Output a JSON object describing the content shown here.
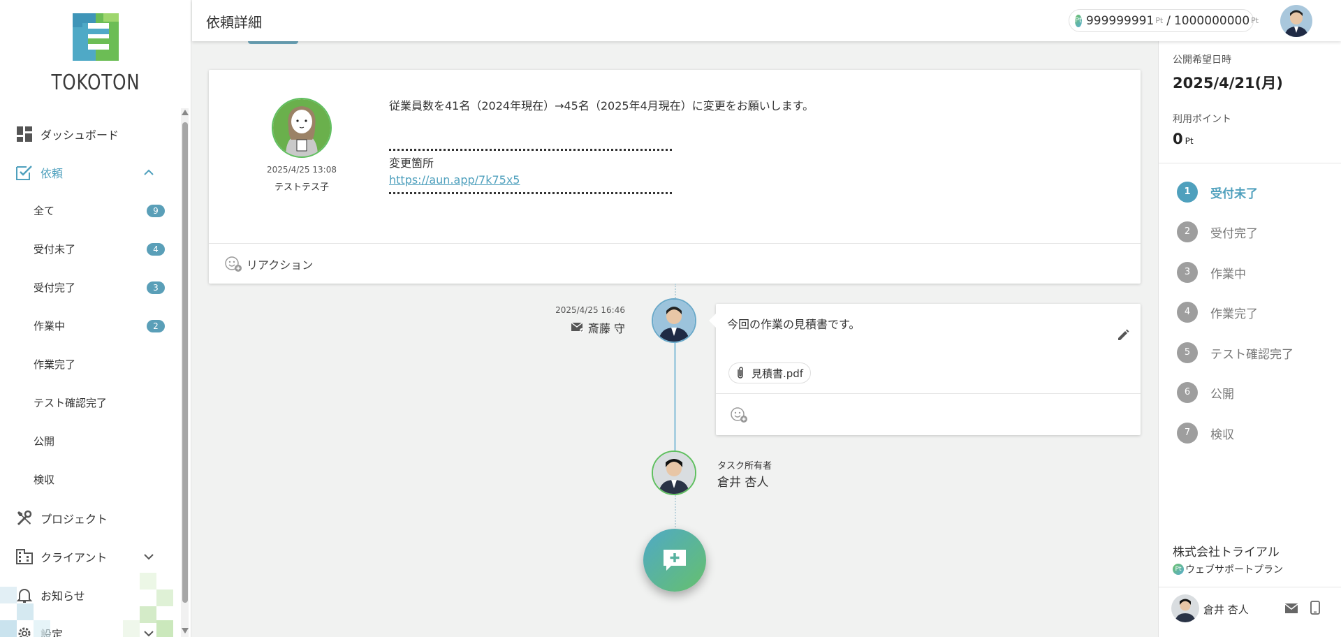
{
  "app": {
    "logo_text": "TOKOTON",
    "brand_colors": {
      "blue": "#4fa0bd",
      "green": "#66c06d",
      "badge": "#5a9fb8"
    }
  },
  "header": {
    "title": "依頼詳細",
    "points_current": "999999991",
    "points_unit": "Pt",
    "points_separator": "/",
    "points_total": "1000000000",
    "pt_badge": "Pt"
  },
  "sidebar": {
    "dashboard": "ダッシュボード",
    "request": "依頼",
    "sub_items": [
      {
        "label": "全て",
        "count": "9"
      },
      {
        "label": "受付未了",
        "count": "4"
      },
      {
        "label": "受付完了",
        "count": "3"
      },
      {
        "label": "作業中",
        "count": "2"
      },
      {
        "label": "作業完了",
        "count": ""
      },
      {
        "label": "テスト確認完了",
        "count": ""
      },
      {
        "label": "公開",
        "count": ""
      },
      {
        "label": "検収",
        "count": ""
      }
    ],
    "project": "プロジェクト",
    "client": "クライアント",
    "notice": "お知らせ",
    "settings": "設定"
  },
  "request_card": {
    "date": "2025/4/25 13:08",
    "author": "テストテス子",
    "body_line1": "従業員数を41名（2024年現在）→45名（2025年4月現在）に変更をお願いします。",
    "change_label": "変更箇所",
    "link": "https://aun.app/7k75x5",
    "reaction_label": "リアクション"
  },
  "message": {
    "date": "2025/4/25 16:46",
    "author": "斎藤 守",
    "text": "今回の作業の見積書です。",
    "attachment": "見積書.pdf"
  },
  "owner": {
    "label": "タスク所有者",
    "name": "倉井 杏人"
  },
  "right_panel": {
    "publish_label": "公開希望日時",
    "publish_date": "2025/4/21(月)",
    "points_label": "利用ポイント",
    "points_value": "0",
    "points_unit": "Pt",
    "steps": [
      {
        "num": "1",
        "label": "受付未了",
        "active": true
      },
      {
        "num": "2",
        "label": "受付完了",
        "active": false
      },
      {
        "num": "3",
        "label": "作業中",
        "active": false
      },
      {
        "num": "4",
        "label": "作業完了",
        "active": false
      },
      {
        "num": "5",
        "label": "テスト確認完了",
        "active": false
      },
      {
        "num": "6",
        "label": "公開",
        "active": false
      },
      {
        "num": "7",
        "label": "検収",
        "active": false
      }
    ],
    "company": "株式会社トライアル",
    "plan": "ウェブサポートプラン",
    "plan_badge": "Pt",
    "user_name": "倉井 杏人"
  }
}
